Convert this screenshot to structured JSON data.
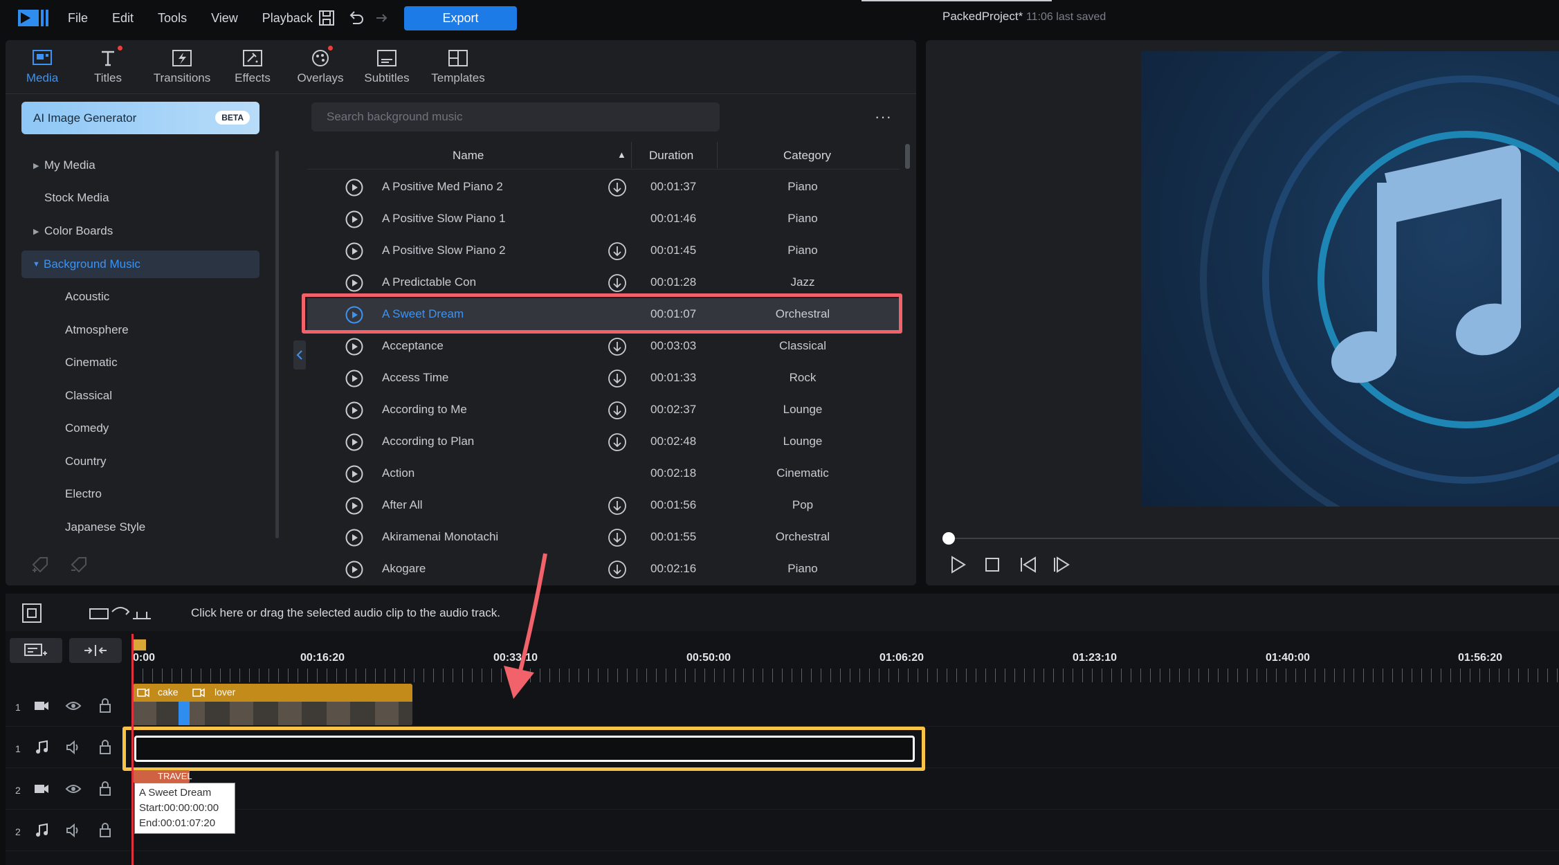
{
  "menu": {
    "items": [
      "File",
      "Edit",
      "Tools",
      "View",
      "Playback"
    ],
    "export_label": "Export",
    "project_name": "PackedProject*",
    "saved_status": "11:06 last saved"
  },
  "library_tabs": [
    {
      "label": "Media",
      "icon": "media-icon",
      "active": true
    },
    {
      "label": "Titles",
      "icon": "titles-icon"
    },
    {
      "label": "Transitions",
      "icon": "transitions-icon"
    },
    {
      "label": "Effects",
      "icon": "effects-icon"
    },
    {
      "label": "Overlays",
      "icon": "overlays-icon"
    },
    {
      "label": "Subtitles",
      "icon": "subtitles-icon"
    },
    {
      "label": "Templates",
      "icon": "templates-icon"
    }
  ],
  "sidebar": {
    "ai_button": "AI Image Generator",
    "ai_badge": "BETA",
    "items": [
      {
        "label": "My Media",
        "caret": "▶"
      },
      {
        "label": "Stock Media",
        "caret": ""
      },
      {
        "label": "Color Boards",
        "caret": "▶"
      },
      {
        "label": "Background Music",
        "caret": "▼",
        "selected": true
      },
      {
        "label": "Acoustic"
      },
      {
        "label": "Atmosphere"
      },
      {
        "label": "Cinematic"
      },
      {
        "label": "Classical"
      },
      {
        "label": "Comedy"
      },
      {
        "label": "Country"
      },
      {
        "label": "Electro"
      },
      {
        "label": "Japanese Style"
      }
    ]
  },
  "search": {
    "placeholder": "Search background music",
    "more_label": "···"
  },
  "table": {
    "headers": {
      "name": "Name",
      "sort": "▲",
      "duration": "Duration",
      "category": "Category"
    },
    "rows": [
      {
        "name": "A Positive Med Piano 2",
        "duration": "00:01:37",
        "category": "Piano",
        "download": true
      },
      {
        "name": "A Positive Slow Piano 1",
        "duration": "00:01:46",
        "category": "Piano",
        "download": false
      },
      {
        "name": "A Positive Slow Piano 2",
        "duration": "00:01:45",
        "category": "Piano",
        "download": true
      },
      {
        "name": "A Predictable Con",
        "duration": "00:01:28",
        "category": "Jazz",
        "download": true
      },
      {
        "name": "A Sweet Dream",
        "duration": "00:01:07",
        "category": "Orchestral",
        "download": false,
        "selected": true
      },
      {
        "name": "Acceptance",
        "duration": "00:03:03",
        "category": "Classical",
        "download": true
      },
      {
        "name": "Access Time",
        "duration": "00:01:33",
        "category": "Rock",
        "download": true
      },
      {
        "name": "According to Me",
        "duration": "00:02:37",
        "category": "Lounge",
        "download": true
      },
      {
        "name": "According to Plan",
        "duration": "00:02:48",
        "category": "Lounge",
        "download": true
      },
      {
        "name": "Action",
        "duration": "00:02:18",
        "category": "Cinematic",
        "download": false
      },
      {
        "name": "After All",
        "duration": "00:01:56",
        "category": "Pop",
        "download": true
      },
      {
        "name": "Akiramenai Monotachi",
        "duration": "00:01:55",
        "category": "Orchestral",
        "download": true
      },
      {
        "name": "Akogare",
        "duration": "00:02:16",
        "category": "Piano",
        "download": true
      }
    ]
  },
  "preview": {
    "scrub_position": 0
  },
  "timeline": {
    "hint": "Click here or drag the selected audio clip to the audio track.",
    "ruler": [
      "0:00",
      "00:16:20",
      "00:33:10",
      "00:50:00",
      "01:06:20",
      "01:23:10",
      "01:40:00",
      "01:56:20"
    ],
    "tracks": [
      {
        "number": "1",
        "kind": "video"
      },
      {
        "number": "1",
        "kind": "audio"
      },
      {
        "number": "2",
        "kind": "video"
      },
      {
        "number": "2",
        "kind": "audio"
      }
    ],
    "clips": {
      "clip1": "cake",
      "clip2": "lover",
      "title_clip": "TRAVEL"
    },
    "tooltip": {
      "title": "A Sweet Dream",
      "start": "Start:00:00:00:00",
      "end": "End:00:01:07:20"
    }
  },
  "colors": {
    "accent": "#1d7be8",
    "selected_text": "#3d93f2",
    "row_highlight": "#f2626b",
    "track_highlight": "#f8c347",
    "clip": "#c38b1a",
    "playhead": "#e0303b"
  }
}
